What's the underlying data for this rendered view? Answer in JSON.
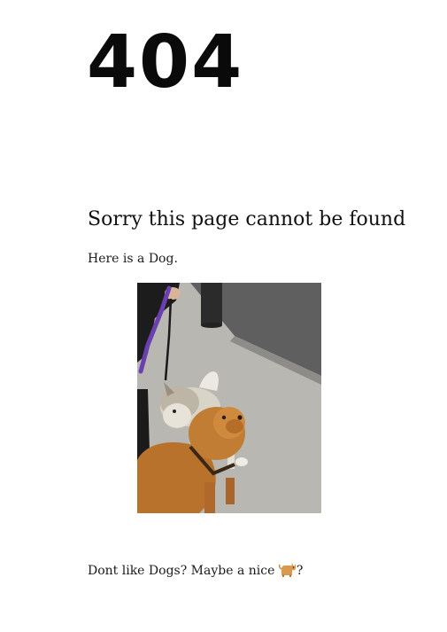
{
  "error": {
    "code": "404",
    "heading": "Sorry this page cannot be found",
    "intro": "Here is a Dog."
  },
  "image": {
    "subject": "dogs-on-leash-photo",
    "alt": "Here is a Dog."
  },
  "footer": {
    "prompt": "Dont like Dogs? Maybe a nice ",
    "link_icon": "cat-emoji-icon",
    "suffix": "?"
  },
  "colors": {
    "link": "#2a4fd6",
    "text": "#111111",
    "background": "#ffffff"
  }
}
